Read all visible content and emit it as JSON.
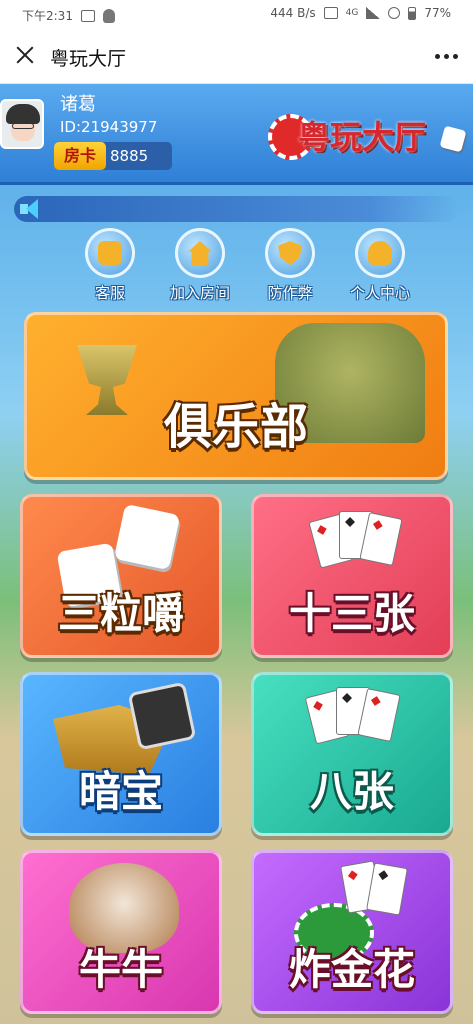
{
  "statusbar": {
    "time": "下午2:31",
    "net_speed": "444 B/s",
    "network_type": "4G",
    "battery": "77%",
    "icons": [
      "image-icon",
      "chat-icon",
      "vibrate-icon",
      "signal-icon",
      "alarm-icon",
      "battery-icon"
    ]
  },
  "titlebar": {
    "title": "粤玩大厅",
    "close_icon": "close-icon",
    "more_icon": "more-icon"
  },
  "user": {
    "name": "诸葛",
    "id_text": "ID:21943977",
    "room_card_label": "房卡",
    "room_card_value": "8885"
  },
  "logo": {
    "text": "粤玩大厅"
  },
  "nav": [
    {
      "label": "客服",
      "icon": "headset-icon"
    },
    {
      "label": "加入房间",
      "icon": "home-icon"
    },
    {
      "label": "防作弊",
      "icon": "shield-icon"
    },
    {
      "label": "个人中心",
      "icon": "person-icon"
    }
  ],
  "games": {
    "club": "俱乐部",
    "sanli": "三粒嚼",
    "shisan": "十三张",
    "anbao": "暗宝",
    "bazhang": "八张",
    "niuniu": "牛牛",
    "zhajinhua": "炸金花"
  },
  "colors": {
    "header_blue": "#2f7fd6",
    "club_orange": "#f07d12",
    "card_gold": "#f0a500"
  }
}
